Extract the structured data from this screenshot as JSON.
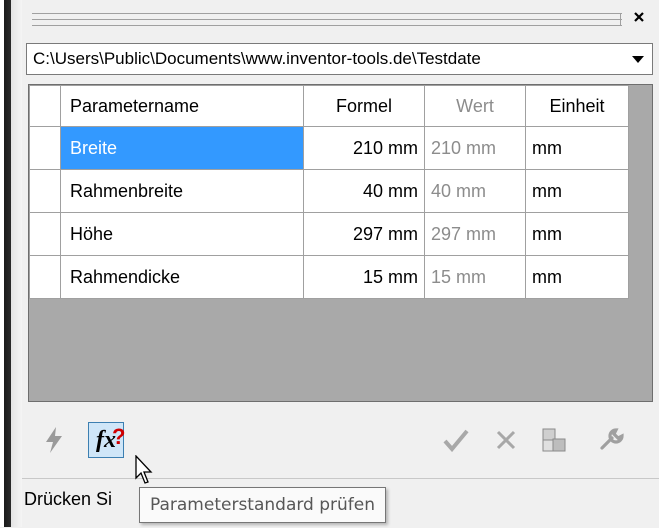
{
  "path_selector": {
    "value": "C:\\Users\\Public\\Documents\\www.inventor-tools.de\\Testdate"
  },
  "table": {
    "columns": [
      "Parametername",
      "Formel",
      "Wert",
      "Einheit"
    ],
    "rows": [
      {
        "name": "Breite",
        "formula": "210 mm",
        "value": "210 mm",
        "unit": "mm"
      },
      {
        "name": "Rahmenbreite",
        "formula": "40 mm",
        "value": "40 mm",
        "unit": "mm"
      },
      {
        "name": "Höhe",
        "formula": "297 mm",
        "value": "297 mm",
        "unit": "mm"
      },
      {
        "name": "Rahmendicke",
        "formula": "15 mm",
        "value": "15 mm",
        "unit": "mm"
      }
    ]
  },
  "toolbar": {
    "icons": [
      "lightning-icon",
      "fx-check-icon",
      "checkmark-icon",
      "delete-x-icon",
      "blocks-icon",
      "wrench-icon"
    ]
  },
  "statusbar": {
    "text": "Drücken Si"
  },
  "tooltip": {
    "text": "Parameterstandard prüfen"
  },
  "colors": {
    "selection": "#3399ff",
    "grid_background": "#a9a9a9",
    "fx_button_bg": "#cfe6f8",
    "fx_question_mark": "#d00000"
  }
}
